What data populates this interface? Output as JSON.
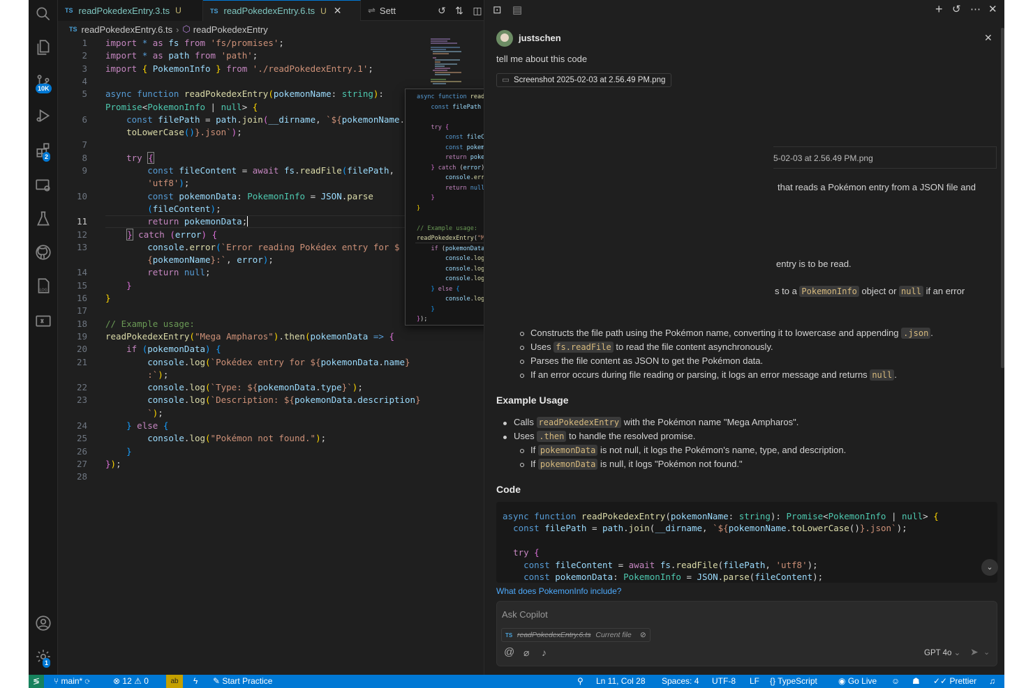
{
  "tabs": [
    {
      "name": "readPokedexEntry.3.ts",
      "status": "U",
      "lang": "TS"
    },
    {
      "name": "readPokedexEntry.6.ts",
      "status": "U",
      "lang": "TS"
    }
  ],
  "tab_overflow_label": "Sett",
  "breadcrumb": {
    "file": "readPokedexEntry.6.ts",
    "symbol": "readPokedexEntry",
    "lang": "TS"
  },
  "activity": {
    "source_control_badge": "10K",
    "extensions_badge": "2",
    "manage_badge": "1"
  },
  "editor": {
    "line_numbers": [
      "1",
      "2",
      "3",
      "4",
      "5",
      "",
      "6",
      "",
      "7",
      "8",
      "9",
      "",
      "10",
      "",
      "11",
      "12",
      "13",
      "",
      "14",
      "15",
      "16",
      "17",
      "18",
      "19",
      "20",
      "21",
      "",
      "22",
      "23",
      "",
      "24",
      "25",
      "26",
      "27",
      "28"
    ],
    "current_line": "11"
  },
  "chat": {
    "user": "justschen",
    "prompt": "tell me about this code",
    "attachment": "Screenshot 2025-02-03 at 2.56.49 PM.png",
    "attachment_echo": "5-02-03 at 2.56.49 PM.png",
    "partial_lines": [
      "that reads a Pokémon entry from a JSON file and",
      "entry is to be read."
    ],
    "returns_line": {
      "prefix": "s to a",
      "type": "PokemonInfo",
      "middle": "object or",
      "nullv": "null",
      "suffix": "if an error"
    },
    "func_sub": [
      {
        "before": "Constructs the file path using the Pokémon name, converting it to lowercase and appending",
        "code": ".json",
        "after": "."
      },
      {
        "before": "Uses",
        "code": "fs.readFile",
        "after": "to read the file content asynchronously."
      },
      {
        "before": "Parses the file content as JSON to get the Pokémon data.",
        "code": "",
        "after": ""
      },
      {
        "before": "If an error occurs during file reading or parsing, it logs an error message and returns",
        "code": "null",
        "after": "."
      }
    ],
    "example_heading": "Example Usage",
    "example_items": [
      {
        "before": "Calls",
        "code": "readPokedexEntry",
        "after": "with the Pokémon name \"Mega Ampharos\"."
      },
      {
        "before": "Uses",
        "code": ".then",
        "after": "to handle the resolved promise."
      }
    ],
    "example_sub": [
      {
        "before": "If",
        "code": "pokemonData",
        "after": "is not null, it logs the Pokémon's name, type, and description."
      },
      {
        "before": "If",
        "code": "pokemonData",
        "after": "is null, it logs \"Pokémon not found.\""
      }
    ],
    "code_heading": "Code",
    "followup": "What does PokemonInfo include?",
    "input_placeholder": "Ask Copilot",
    "context_file": "readPokedexEntry.6.ts",
    "context_label": "Current file",
    "model": "GPT 4o"
  },
  "status": {
    "branch": "main*",
    "errors": "12",
    "warnings": "0",
    "practice": "Start Practice",
    "position": "Ln 11, Col 28",
    "spaces": "Spaces: 4",
    "encoding": "UTF-8",
    "eol": "LF",
    "language": "TypeScript",
    "golive": "Go Live",
    "prettier": "Prettier"
  }
}
